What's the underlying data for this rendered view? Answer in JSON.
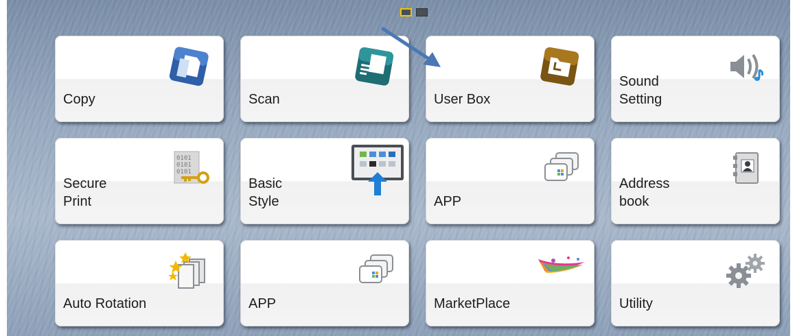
{
  "pagination": {
    "pages": 2,
    "current": 1
  },
  "tiles": [
    {
      "label": "Copy",
      "icon": "copy-icon"
    },
    {
      "label": "Scan",
      "icon": "scan-icon"
    },
    {
      "label": "User Box",
      "icon": "user-box-icon"
    },
    {
      "label": "Sound\nSetting",
      "icon": "speaker-icon"
    },
    {
      "label": "Secure\nPrint",
      "icon": "secure-print-icon"
    },
    {
      "label": "Basic\nStyle",
      "icon": "basic-style-icon"
    },
    {
      "label": "APP",
      "icon": "app-icon"
    },
    {
      "label": "Address\nbook",
      "icon": "address-book-icon"
    },
    {
      "label": "Auto Rotation",
      "icon": "auto-rotation-icon"
    },
    {
      "label": "APP",
      "icon": "app-icon"
    },
    {
      "label": "MarketPlace",
      "icon": "marketplace-icon"
    },
    {
      "label": "Utility",
      "icon": "gears-icon"
    }
  ],
  "annotation": {
    "icon": "arrow-icon",
    "color": "#4a78b4"
  },
  "colors": {
    "copy": "#2e5fa8",
    "scan": "#1e6e74",
    "user_box": "#7a5412",
    "accent_dot": "#f3c400"
  }
}
